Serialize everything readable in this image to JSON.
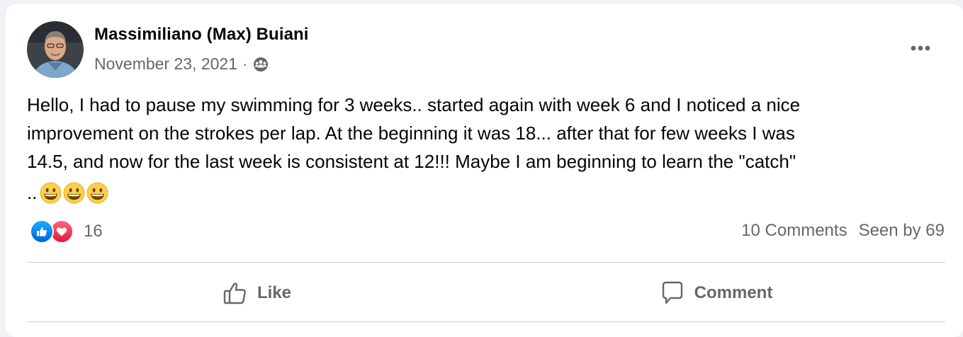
{
  "post": {
    "author": "Massimiliano (Max) Buiani",
    "date": "November 23, 2021",
    "separator": "·",
    "audience_icon": "group-icon",
    "body": "Hello, I had to pause my swimming for 3 weeks.. started again with week 6 and I noticed a nice\nimprovement on the strokes per lap. At the beginning it was 18... after that for few weeks I was\n14.5, and now for the last week is consistent at 12!!! Maybe I am beginning to learn the \"catch\"",
    "body_tail": "..",
    "emojis": [
      "grinning-face-emoji",
      "grinning-face-emoji",
      "grinning-face-emoji"
    ]
  },
  "reactions": {
    "icons": [
      "like-reaction-icon",
      "love-reaction-icon"
    ],
    "count": "16"
  },
  "stats": {
    "comments": "10 Comments",
    "seen_by": "Seen by 69"
  },
  "actions": {
    "like_label": "Like",
    "comment_label": "Comment"
  },
  "colors": {
    "text_primary": "#050505",
    "text_secondary": "#65676b",
    "like_blue": "#0866ff",
    "love_red": "#f33e58",
    "divider": "#ced0d4"
  }
}
